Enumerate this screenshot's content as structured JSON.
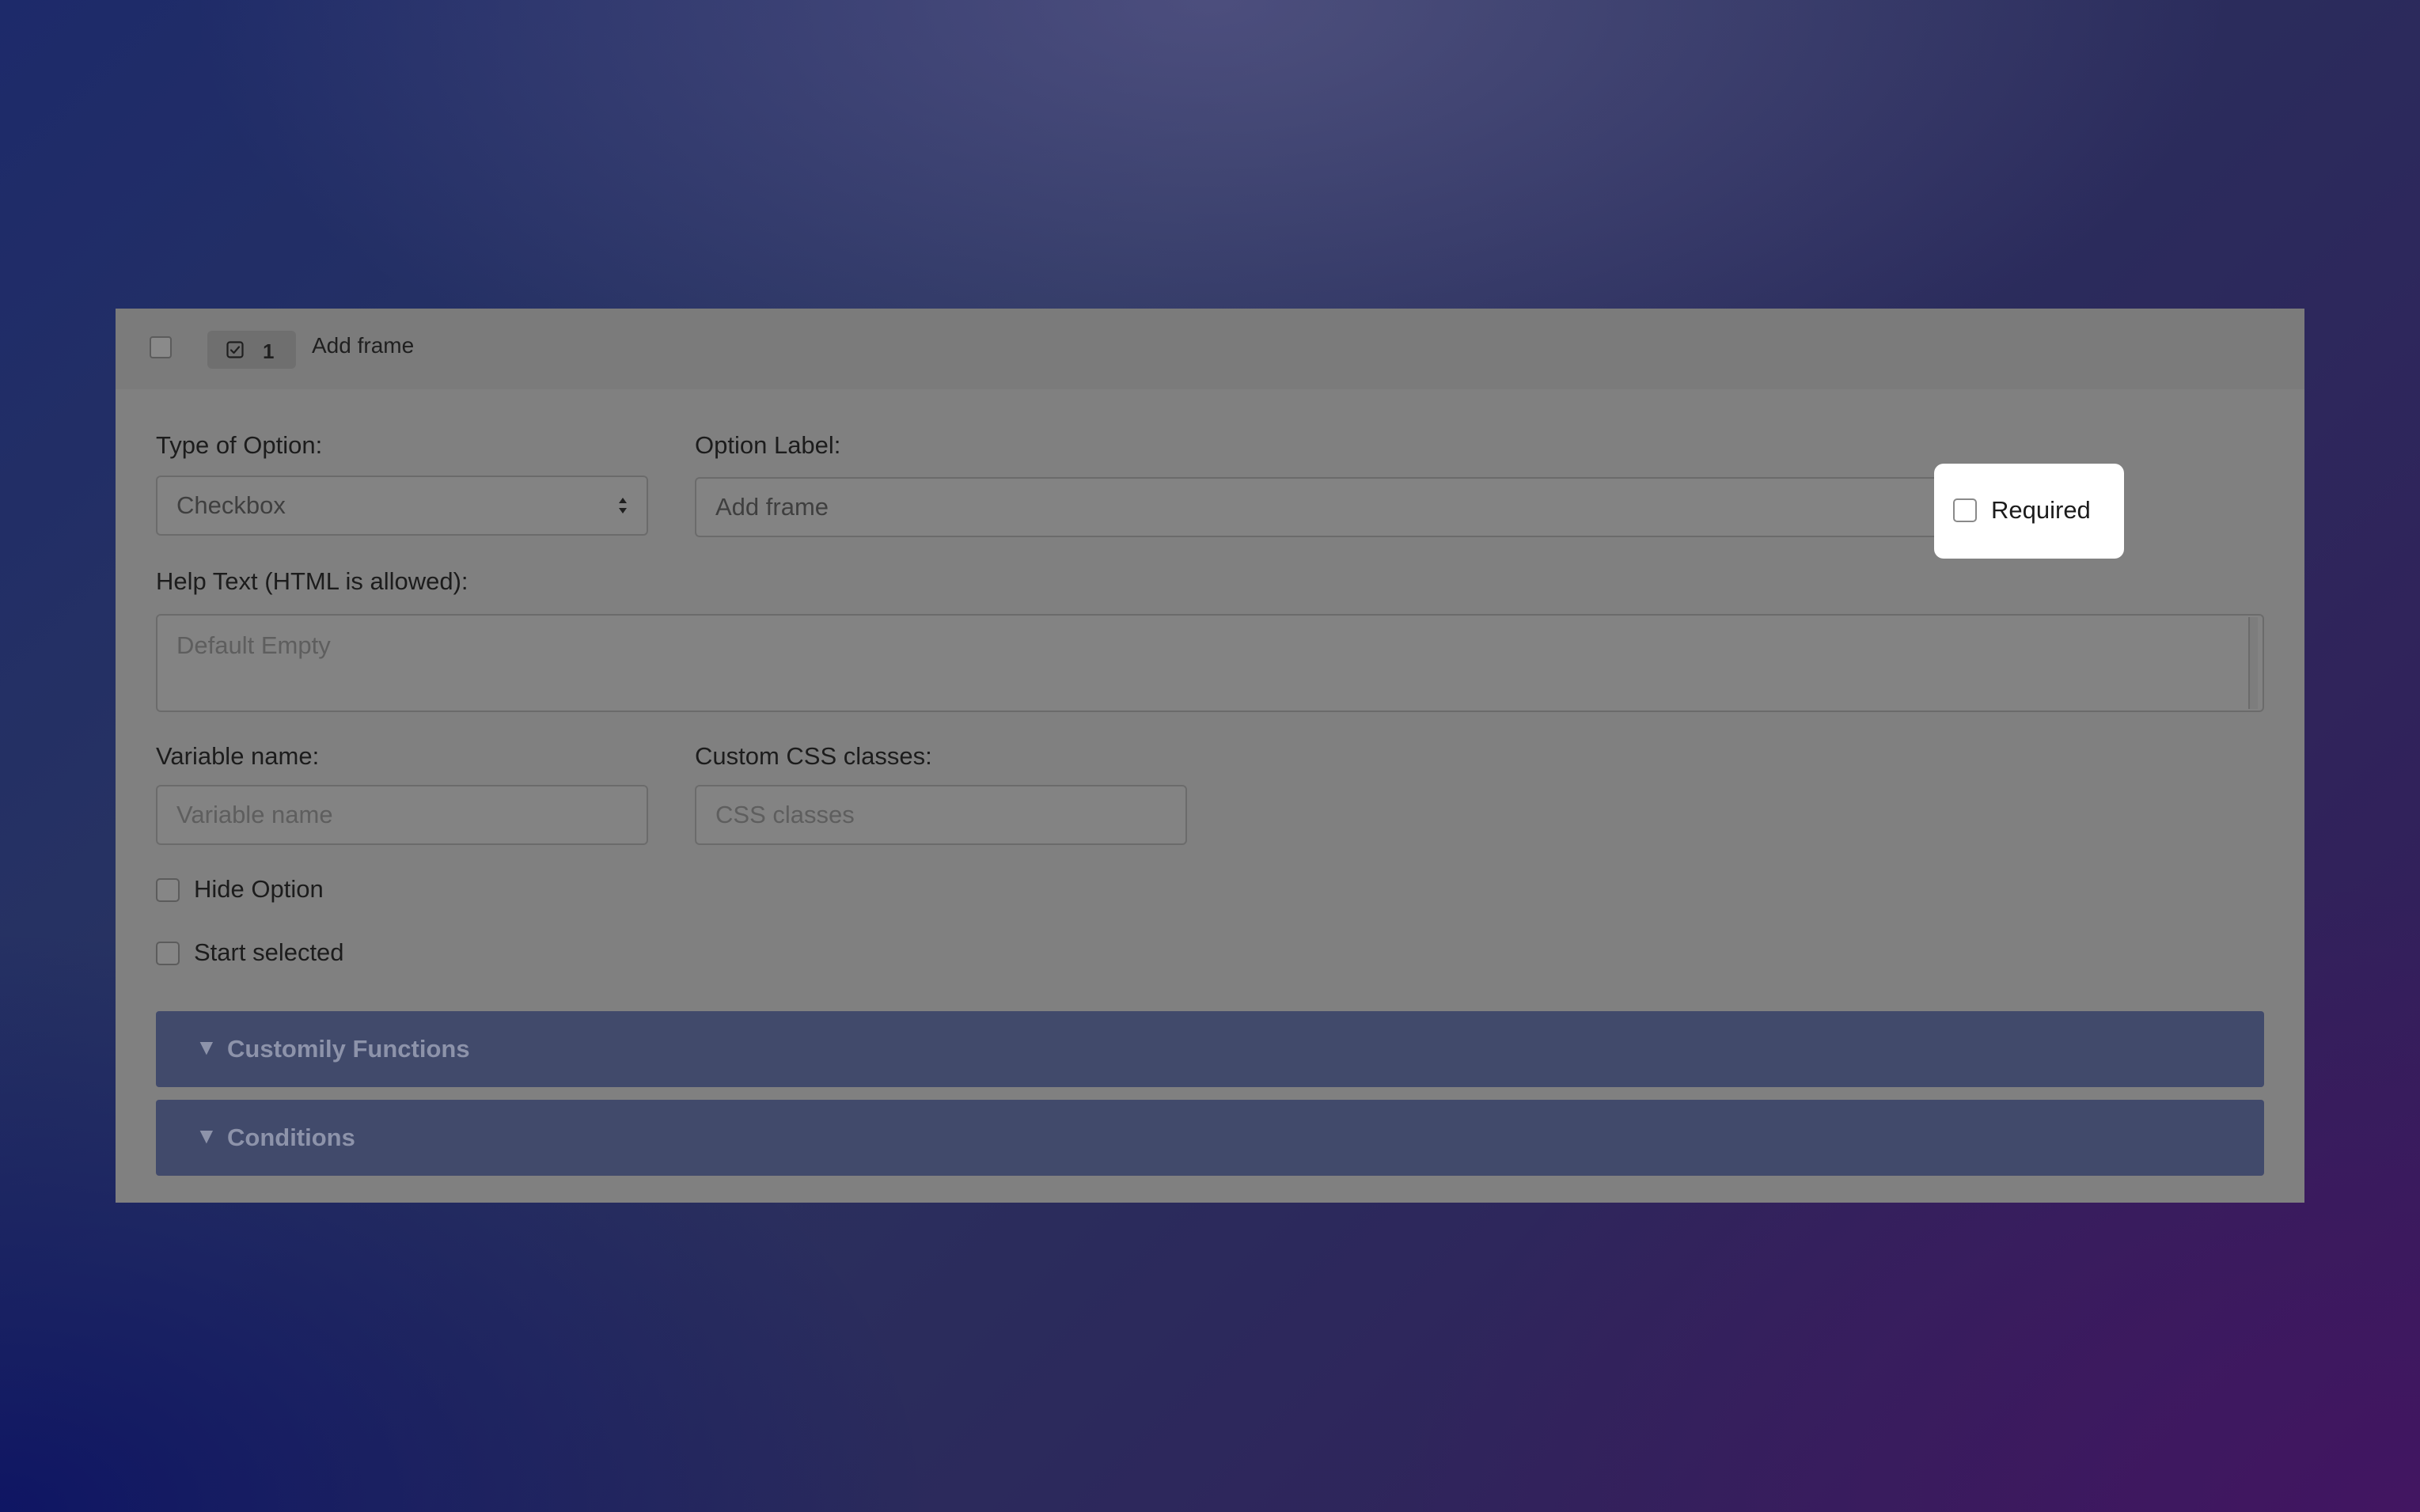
{
  "header": {
    "chip_number": "1",
    "title": "Add frame"
  },
  "form": {
    "type_label": "Type of Option:",
    "type_value": "Checkbox",
    "option_label_label": "Option Label:",
    "option_label_value": "Add frame",
    "required_label": "Required",
    "help_text_label": "Help Text (HTML is allowed):",
    "help_text_placeholder": "Default Empty",
    "variable_name_label": "Variable name:",
    "variable_name_placeholder": "Variable name",
    "css_label": "Custom CSS classes:",
    "css_placeholder": "CSS classes",
    "hide_option_label": "Hide Option",
    "start_selected_label": "Start selected"
  },
  "sections": {
    "arrow": "▼",
    "customily_functions": "Customily Functions",
    "conditions": "Conditions"
  },
  "icons": {
    "header_checkbox": "checkbox-icon",
    "type_chip": "checked-box-icon",
    "select_arrows": "sort-arrows-icon"
  },
  "colors": {
    "panel": "#808080",
    "accordion": "#414a6b",
    "highlight": "#ffffff"
  }
}
